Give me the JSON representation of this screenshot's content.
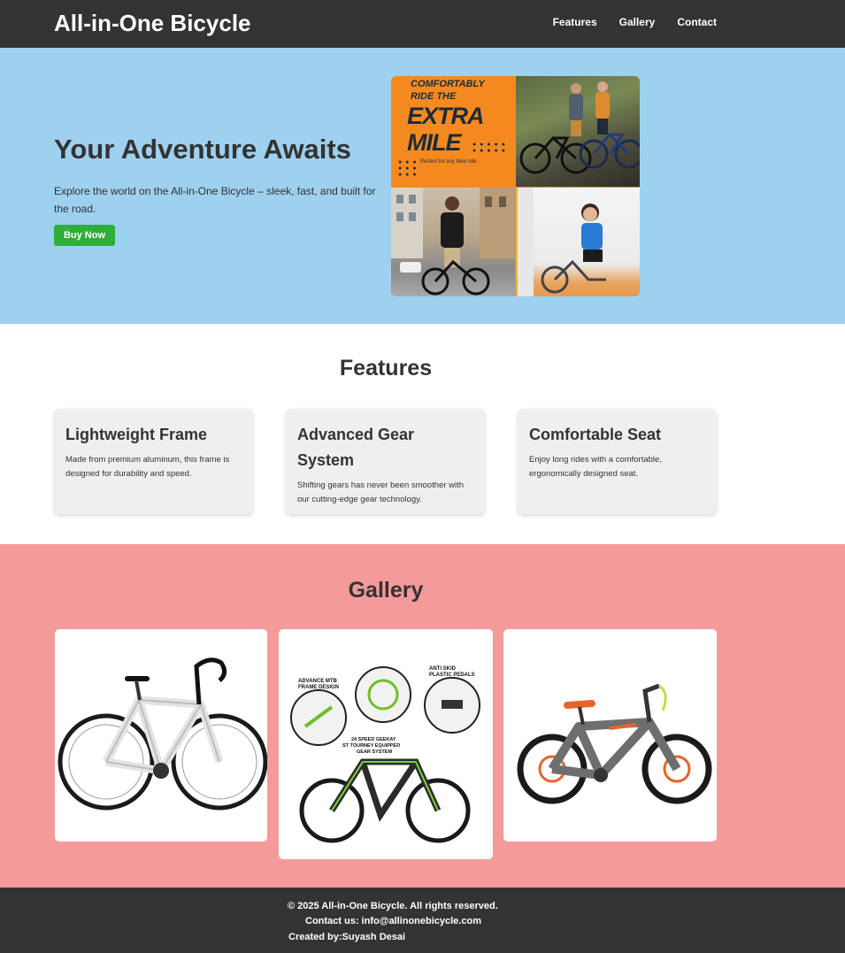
{
  "header": {
    "brand": "All-in-One Bicycle",
    "nav": [
      "Features",
      "Gallery",
      "Contact"
    ]
  },
  "hero": {
    "title": "Your Adventure Awaits",
    "text": "Explore the world on the All-in-One Bicycle – sleek, fast, and built for the road.",
    "button": "Buy Now",
    "promo": {
      "line1": "COMFORTABLY",
      "line2": "RIDE THE",
      "line3": "EXTRA",
      "line4": "MILE",
      "line5": "Perfect for any bike ride"
    }
  },
  "features": {
    "title": "Features",
    "cards": [
      {
        "title": "Lightweight Frame",
        "text": "Made from premium aluminum, this frame is designed for durability and speed."
      },
      {
        "title": "Advanced Gear System",
        "text": "Shifting gears has never been smoother with our cutting-edge gear technology."
      },
      {
        "title": "Comfortable Seat",
        "text": "Enjoy long rides with a comfortable, ergonomically designed seat."
      }
    ]
  },
  "gallery": {
    "title": "Gallery",
    "callouts": {
      "frame": "ADVANCE MTB FRAME DESIGN",
      "pedals": "ANTI SKID PLASTIC PEDALS",
      "gears": "24 SPEED GEEKAY ST TOURNEY EQUIPPED GEAR SYSTEM"
    }
  },
  "footer": {
    "copyright": "© 2025 All-in-One Bicycle. All rights reserved.",
    "contact": "Contact us: info@allinonebicycle.com",
    "created": "Created by:Suyash Desai"
  },
  "colors": {
    "header_bg": "#333333",
    "hero_bg": "#9ed0ef",
    "gallery_bg": "#f59a9a",
    "button_bg": "#2fae3a",
    "card_bg": "#efefef"
  }
}
